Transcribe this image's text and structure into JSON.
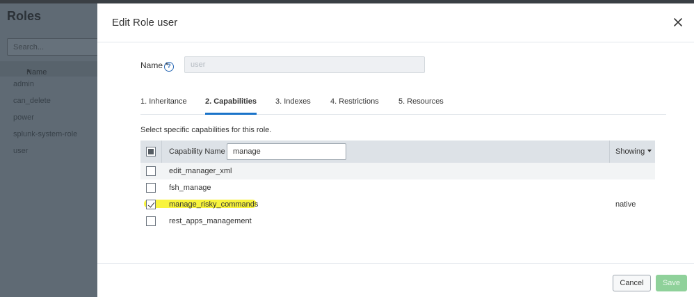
{
  "background": {
    "title": "Roles",
    "search_placeholder": "Search...",
    "column_header": "Name",
    "sort_indicator": "▲",
    "rows": [
      "admin",
      "can_delete",
      "power",
      "splunk-system-role",
      "user"
    ]
  },
  "modal": {
    "title": "Edit Role user",
    "close_icon": "close-icon",
    "name_label": "Name",
    "required_mark": "*",
    "help_icon": "?",
    "name_value": "user",
    "tabs": [
      {
        "label": "1. Inheritance",
        "active": false
      },
      {
        "label": "2. Capabilities",
        "active": true
      },
      {
        "label": "3. Indexes",
        "active": false
      },
      {
        "label": "4. Restrictions",
        "active": false
      },
      {
        "label": "5. Resources",
        "active": false
      }
    ],
    "description": "Select specific capabilities for this role.",
    "table": {
      "header_capability": "Capability Name",
      "filter_value": "manage",
      "header_showing": "Showing",
      "rows": [
        {
          "name": "edit_manager_xml",
          "checked": false,
          "source": ""
        },
        {
          "name": "fsh_manage",
          "checked": false,
          "source": ""
        },
        {
          "name": "manage_risky_commands",
          "checked": true,
          "source": "native",
          "highlighted": true
        },
        {
          "name": "rest_apps_management",
          "checked": false,
          "source": ""
        }
      ]
    },
    "footer": {
      "cancel_label": "Cancel",
      "save_label": "Save"
    }
  },
  "colors": {
    "accent": "#1a73c9",
    "save_disabled": "#8fd19a",
    "highlight": "#f7f21a"
  }
}
